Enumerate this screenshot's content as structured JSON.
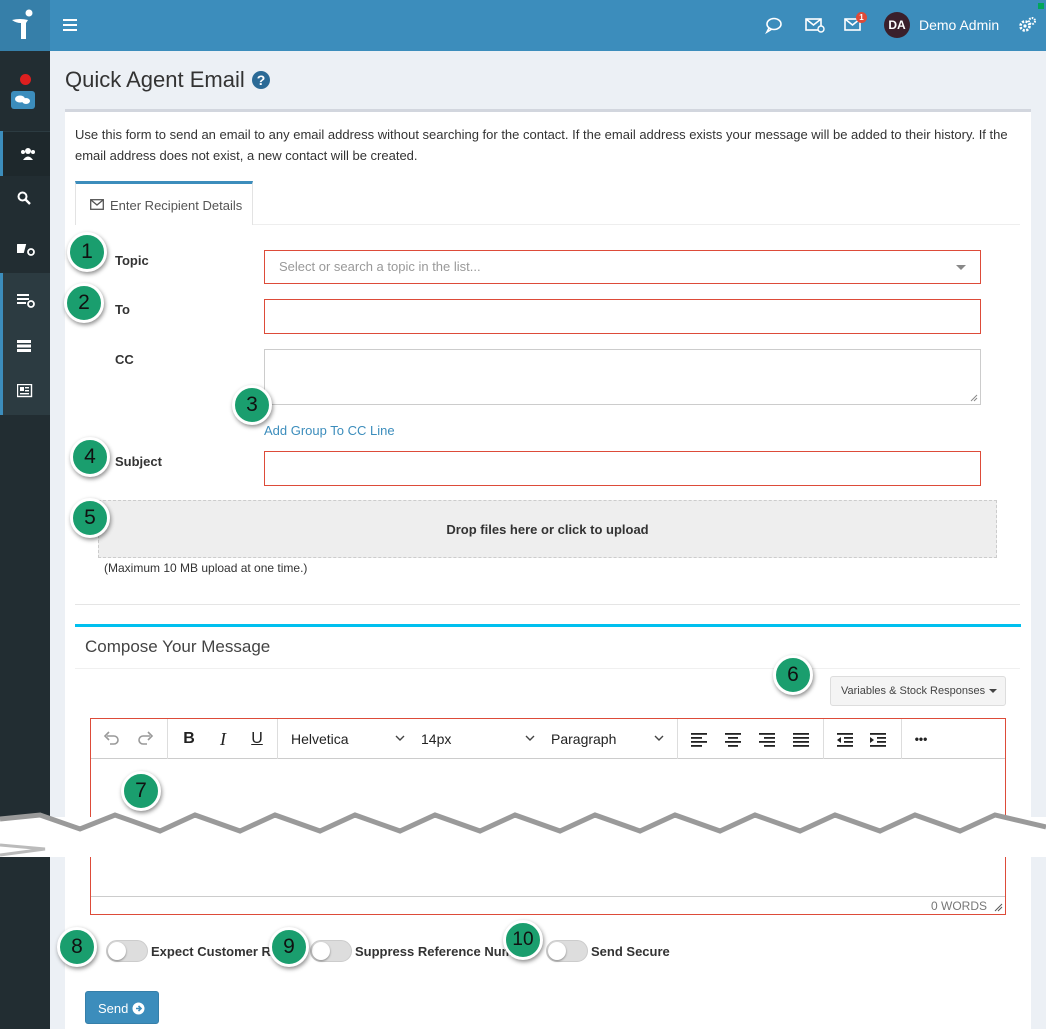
{
  "topbar": {
    "user_initials": "DA",
    "user_name": "Demo Admin",
    "notification_count": "1"
  },
  "page": {
    "title": "Quick Agent Email",
    "intro": "Use this form to send an email to any email address without searching for the contact. If the email address exists your message will be added to their history. If the email address does not exist, a new contact will be created."
  },
  "tab": {
    "label": "Enter Recipient Details"
  },
  "form": {
    "topic_label": "Topic",
    "topic_placeholder": "Select or search a topic in the list...",
    "to_label": "To",
    "cc_label": "CC",
    "add_group_link": "Add Group To CC Line",
    "subject_label": "Subject",
    "dropzone_text": "Drop files here or click to upload",
    "max_upload_note": "(Maximum 10 MB upload at one time.)"
  },
  "compose": {
    "title": "Compose Your Message",
    "variables_button": "Variables & Stock Responses",
    "font_family": "Helvetica",
    "font_size": "14px",
    "block_format": "Paragraph",
    "word_count": "0 WORDS",
    "bold": "B",
    "italic": "I",
    "underline": "U",
    "more": "•••"
  },
  "options": {
    "expect_reply": "Expect Customer Re",
    "suppress_reference": "Suppress Reference Numb",
    "send_secure": "Send Secure"
  },
  "send_button": "Send",
  "callouts": [
    "1",
    "2",
    "3",
    "4",
    "5",
    "6",
    "7",
    "8",
    "9",
    "10"
  ],
  "colors": {
    "primary": "#3c8dbc",
    "sidebar": "#222d32",
    "error_border": "#dd4b39",
    "callout": "#1a9e6e",
    "compose_accent": "#00c0ef"
  }
}
